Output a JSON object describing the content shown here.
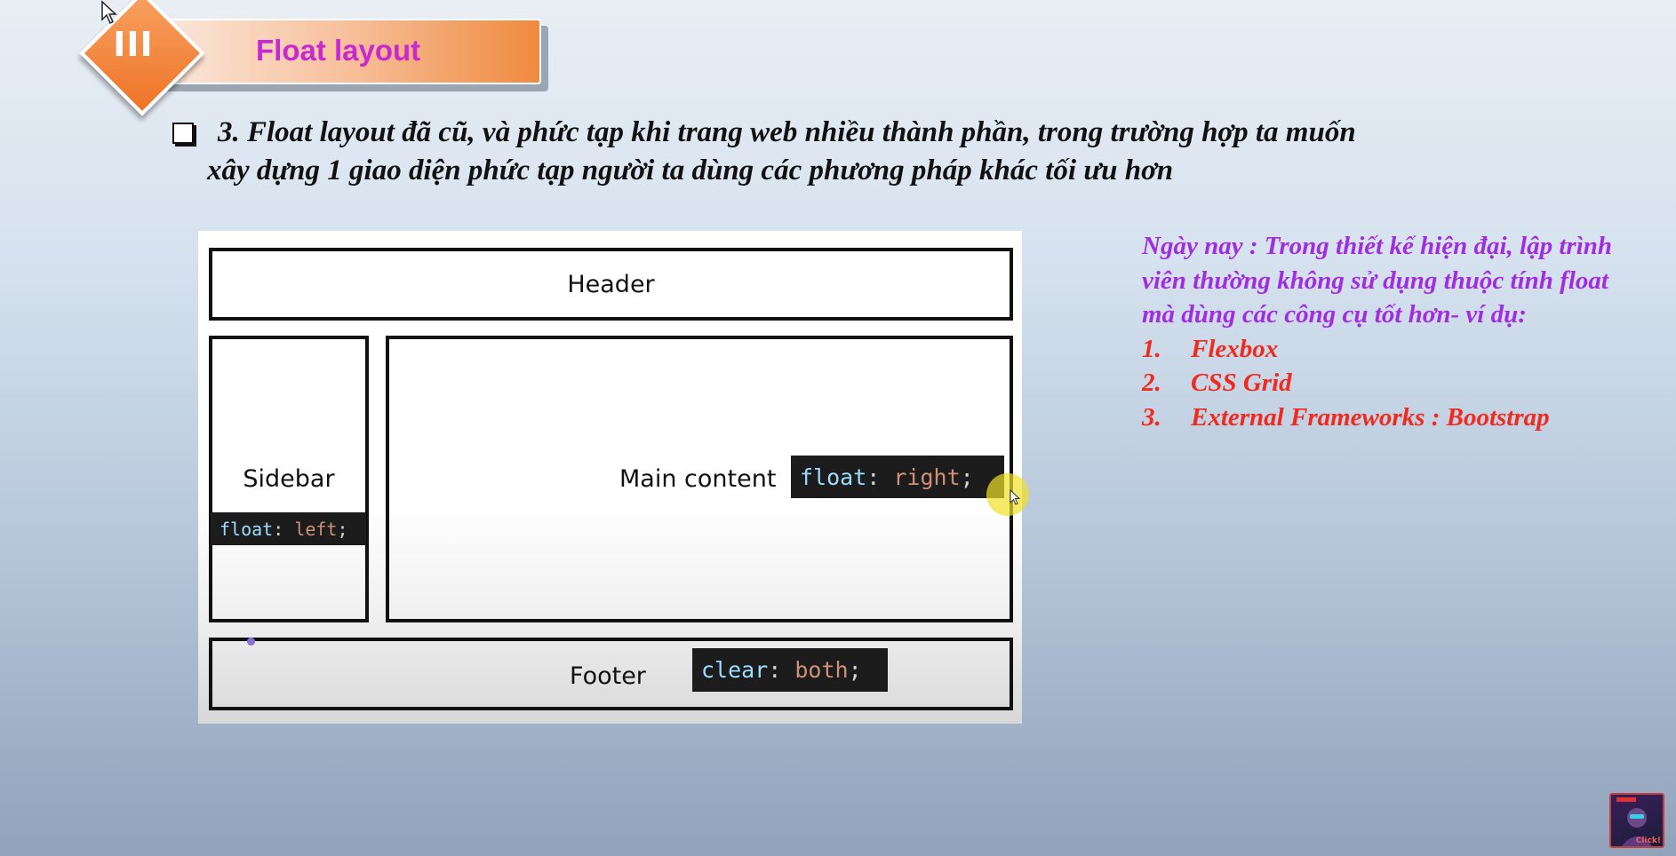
{
  "header": {
    "section_number": "III",
    "title": "Float layout"
  },
  "intro": {
    "line1": "3. Float layout đã cũ, và phức tạp khi trang web nhiều thành phần, trong trường hợp ta muốn",
    "line2": "xây dựng 1 giao diện phức tạp người ta dùng các phương pháp khác tối ưu hơn"
  },
  "diagram": {
    "header_label": "Header",
    "sidebar_label": "Sidebar",
    "main_label": "Main content",
    "footer_label": "Footer",
    "code_left": {
      "prop": "float",
      "colon": ": ",
      "value": "left",
      "semi": ";"
    },
    "code_right": {
      "prop": "float",
      "colon": ": ",
      "value": "right",
      "semi": ";"
    },
    "code_clear": {
      "prop": "clear",
      "colon": ": ",
      "value": "both",
      "semi": ";"
    }
  },
  "note": {
    "paragraph": "Ngày nay : Trong thiết kế hiện đại, lập trình viên thường không sử dụng thuộc tính float mà dùng các công cụ tốt hơn- ví dụ:",
    "items": [
      {
        "num": "1.",
        "text": "Flexbox"
      },
      {
        "num": "2.",
        "text": "CSS Grid"
      },
      {
        "num": "3.",
        "text": "External Frameworks : Bootstrap"
      }
    ]
  },
  "thumbnail": {
    "label": "Click!"
  },
  "colors": {
    "accent_orange": "#ee7426",
    "title_magenta": "#c828d2",
    "note_purple": "#a02ee0",
    "note_red": "#ef2a1e"
  }
}
